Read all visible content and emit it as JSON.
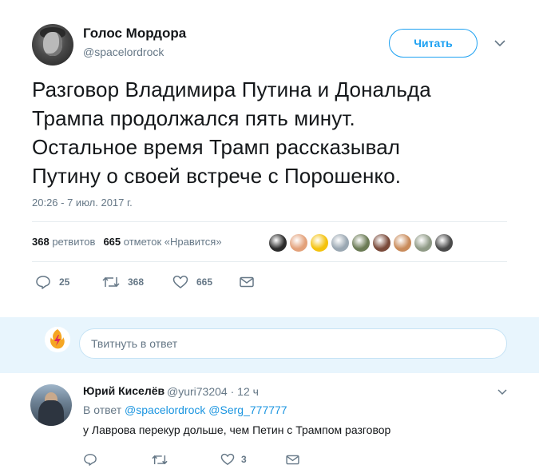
{
  "tweet": {
    "author_name": "Голос Мордора",
    "author_handle": "@spacelordrock",
    "follow_label": "Читать",
    "text_lines": [
      "Разговор Владимира Путина и Дональда",
      "Трампа продолжался пять минут.",
      "Остальное время Трамп рассказывал",
      "Путину о своей встрече с Порошенко."
    ],
    "timestamp": "20:26 - 7 июл. 2017 г.",
    "retweets_count": "368",
    "retweets_label": "ретвитов",
    "likes_count": "665",
    "likes_label": "отметок «Нравится»",
    "liker_colors": [
      "#2b2b2b",
      "#e3a17a",
      "#f4c20d",
      "#9aa7b2",
      "#6b7b55",
      "#7a4a3a",
      "#c98b5a",
      "#8f9a86",
      "#4a4a4a"
    ],
    "actions": {
      "reply_count": "25",
      "retweet_count": "368",
      "like_count": "665",
      "icons": [
        "reply-icon",
        "retweet-icon",
        "heart-icon",
        "envelope-icon"
      ]
    }
  },
  "reply_box": {
    "placeholder": "Твитнуть в ответ"
  },
  "reply": {
    "author_name": "Юрий Киселёв",
    "author_handle": "@yuri73204",
    "separator": "·",
    "time": "12 ч",
    "replying_to_prefix": "В ответ",
    "replying_to_1": "@spacelordrock",
    "replying_to_2": "@Serg_777777",
    "text": "у Лаврова перекур дольше, чем Петин с Трампом разговор",
    "like_count": "3"
  },
  "colors": {
    "accent": "#1da1f2",
    "muted": "#657786",
    "reply_bg": "#e8f5fd",
    "retweet_icon_color": "#657786"
  }
}
